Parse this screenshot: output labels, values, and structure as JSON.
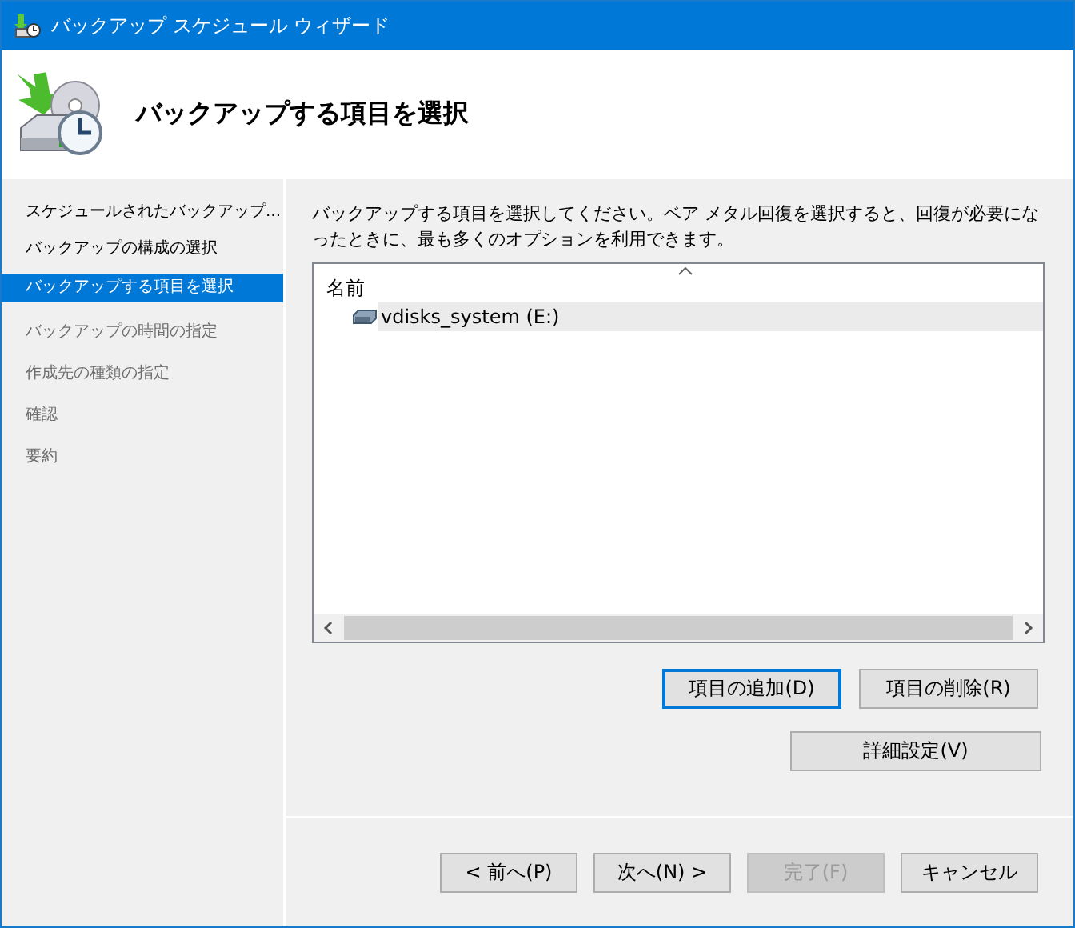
{
  "window": {
    "title": "バックアップ スケジュール ウィザード"
  },
  "header": {
    "title": "バックアップする項目を選択"
  },
  "steps": [
    {
      "label": "スケジュールされたバックアップ...",
      "selected": false,
      "disabled": false
    },
    {
      "label": "バックアップの構成の選択",
      "selected": false,
      "disabled": false
    },
    {
      "label": "バックアップする項目を選択",
      "selected": true,
      "disabled": false
    },
    {
      "label": "バックアップの時間の指定",
      "selected": false,
      "disabled": true
    },
    {
      "label": "作成先の種類の指定",
      "selected": false,
      "disabled": true
    },
    {
      "label": "確認",
      "selected": false,
      "disabled": true
    },
    {
      "label": "要約",
      "selected": false,
      "disabled": true
    }
  ],
  "description": "バックアップする項目を選択してください。ベア メタル回復を選択すると、回復が必要になったときに、最も多くのオプションを利用できます。",
  "list": {
    "column": "名前",
    "rows": [
      {
        "name": "vdisks_system (E:)",
        "selected": true
      }
    ]
  },
  "item_buttons": [
    {
      "label": "項目の追加(D)",
      "focused": true,
      "disabled": false
    },
    {
      "label": "項目の削除(R)",
      "focused": false,
      "disabled": false
    }
  ],
  "advanced_button": {
    "label": "詳細設定(V)",
    "focused": false,
    "disabled": false
  },
  "nav_buttons": [
    {
      "label": "< 前へ(P)",
      "focused": false,
      "disabled": false
    },
    {
      "label": "次へ(N) >",
      "focused": false,
      "disabled": false
    },
    {
      "label": "完了(F)",
      "focused": false,
      "disabled": true
    },
    {
      "label": "キャンセル",
      "focused": false,
      "disabled": false
    }
  ]
}
